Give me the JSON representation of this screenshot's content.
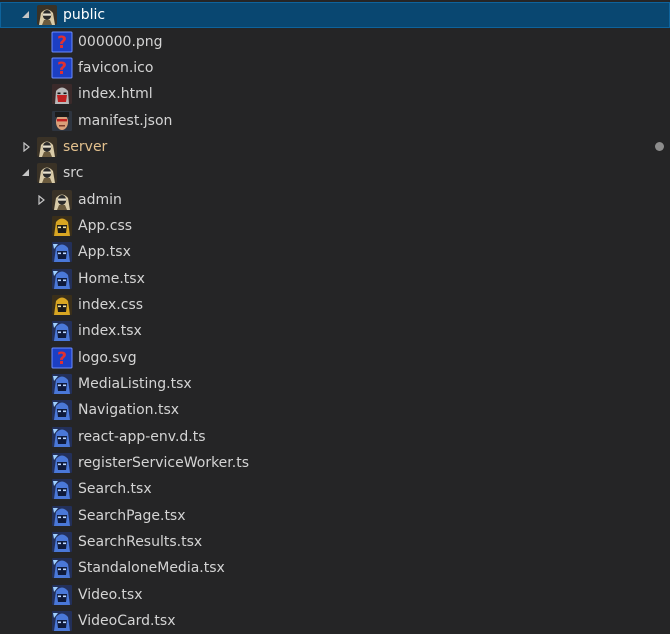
{
  "explorer": {
    "items": [
      {
        "label": "public",
        "type": "folder",
        "expanded": true,
        "depth": 0,
        "selected": true,
        "icon": "folder-avatar-icon"
      },
      {
        "label": "000000.png",
        "type": "file",
        "depth": 1,
        "icon": "unknown-question-icon"
      },
      {
        "label": "favicon.ico",
        "type": "file",
        "depth": 1,
        "icon": "unknown-question-icon"
      },
      {
        "label": "index.html",
        "type": "file",
        "depth": 1,
        "icon": "html-mask-icon"
      },
      {
        "label": "manifest.json",
        "type": "file",
        "depth": 1,
        "icon": "json-face-icon"
      },
      {
        "label": "server",
        "type": "folder",
        "expanded": false,
        "depth": 0,
        "modified": true,
        "icon": "folder-avatar-icon"
      },
      {
        "label": "src",
        "type": "folder",
        "expanded": true,
        "depth": 0,
        "icon": "folder-avatar-icon"
      },
      {
        "label": "admin",
        "type": "folder",
        "expanded": false,
        "depth": 1,
        "icon": "folder-avatar-icon"
      },
      {
        "label": "App.css",
        "type": "file",
        "depth": 1,
        "icon": "css-mask-icon"
      },
      {
        "label": "App.tsx",
        "type": "file",
        "depth": 1,
        "icon": "tsx-mask-icon"
      },
      {
        "label": "Home.tsx",
        "type": "file",
        "depth": 1,
        "icon": "tsx-mask-icon"
      },
      {
        "label": "index.css",
        "type": "file",
        "depth": 1,
        "icon": "css-mask-icon"
      },
      {
        "label": "index.tsx",
        "type": "file",
        "depth": 1,
        "icon": "tsx-mask-icon"
      },
      {
        "label": "logo.svg",
        "type": "file",
        "depth": 1,
        "icon": "unknown-question-icon"
      },
      {
        "label": "MediaListing.tsx",
        "type": "file",
        "depth": 1,
        "icon": "tsx-mask-icon"
      },
      {
        "label": "Navigation.tsx",
        "type": "file",
        "depth": 1,
        "icon": "tsx-mask-icon"
      },
      {
        "label": "react-app-env.d.ts",
        "type": "file",
        "depth": 1,
        "icon": "tsx-mask-icon"
      },
      {
        "label": "registerServiceWorker.ts",
        "type": "file",
        "depth": 1,
        "icon": "tsx-mask-icon"
      },
      {
        "label": "Search.tsx",
        "type": "file",
        "depth": 1,
        "icon": "tsx-mask-icon"
      },
      {
        "label": "SearchPage.tsx",
        "type": "file",
        "depth": 1,
        "icon": "tsx-mask-icon"
      },
      {
        "label": "SearchResults.tsx",
        "type": "file",
        "depth": 1,
        "icon": "tsx-mask-icon"
      },
      {
        "label": "StandaloneMedia.tsx",
        "type": "file",
        "depth": 1,
        "icon": "tsx-mask-icon"
      },
      {
        "label": "Video.tsx",
        "type": "file",
        "depth": 1,
        "icon": "tsx-mask-icon"
      },
      {
        "label": "VideoCard.tsx",
        "type": "file",
        "depth": 1,
        "icon": "tsx-mask-icon"
      }
    ]
  },
  "colors": {
    "background": "#252526",
    "selection": "#094771",
    "text": "#d4d4d4",
    "modified_text": "#e2c08d",
    "decoration_dot": "#8c8c8c"
  }
}
